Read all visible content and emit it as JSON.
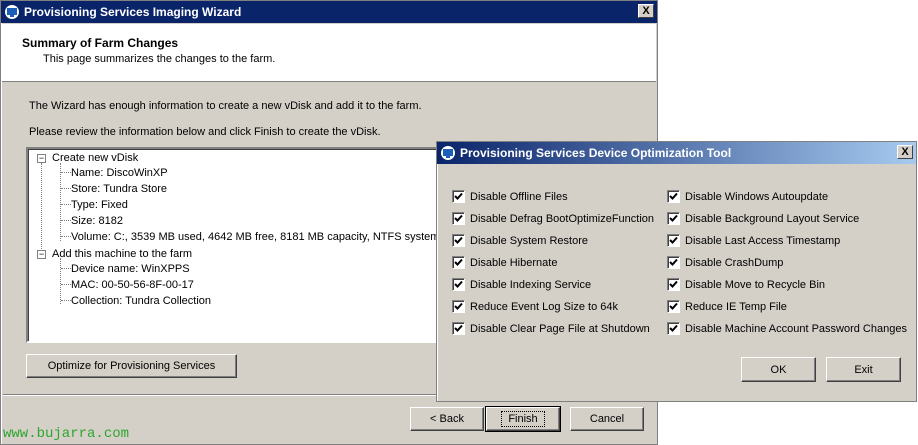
{
  "wizard": {
    "title": "Provisioning Services Imaging Wizard",
    "close_label": "X",
    "header_title": "Summary of Farm Changes",
    "header_subtitle": "This page summarizes the changes to the farm.",
    "intro_text": "The Wizard has enough information to create a new vDisk and add it to the farm.",
    "review_text": "Please review the information below and click Finish to create the vDisk.",
    "tree": [
      {
        "label": "Create new vDisk",
        "children": [
          "Name: DiscoWinXP",
          "Store: Tundra Store",
          "Type: Fixed",
          "Size: 8182",
          "Volume: C:, 3539 MB used, 4642 MB free, 8181 MB capacity, NTFS system"
        ]
      },
      {
        "label": "Add this machine to the farm",
        "children": [
          "Device name: WinXPPS",
          "MAC: 00-50-56-8F-00-17",
          "Collection: Tundra Collection"
        ]
      }
    ],
    "optimize_button": "Optimize for Provisioning Services",
    "back_button": "< Back",
    "finish_button": "Finish",
    "cancel_button": "Cancel"
  },
  "tool": {
    "title": "Provisioning Services Device Optimization Tool",
    "close_label": "X",
    "left_options": [
      {
        "label": "Disable Offline Files",
        "checked": true
      },
      {
        "label": "Disable Defrag BootOptimizeFunction",
        "checked": true
      },
      {
        "label": "Disable System Restore",
        "checked": true
      },
      {
        "label": "Disable Hibernate",
        "checked": true
      },
      {
        "label": "Disable Indexing Service",
        "checked": true
      },
      {
        "label": "Reduce Event Log Size to 64k",
        "checked": true
      },
      {
        "label": "Disable Clear Page File at Shutdown",
        "checked": true
      }
    ],
    "right_options": [
      {
        "label": "Disable Windows Autoupdate",
        "checked": true
      },
      {
        "label": "Disable Background Layout Service",
        "checked": true
      },
      {
        "label": "Disable Last Access Timestamp",
        "checked": true
      },
      {
        "label": "Disable CrashDump",
        "checked": true
      },
      {
        "label": "Disable Move to Recycle Bin",
        "checked": true
      },
      {
        "label": "Reduce IE Temp File",
        "checked": true
      },
      {
        "label": "Disable Machine Account Password Changes",
        "checked": true
      }
    ],
    "ok_button": "OK",
    "exit_button": "Exit"
  },
  "watermark": "www.bujarra.com"
}
